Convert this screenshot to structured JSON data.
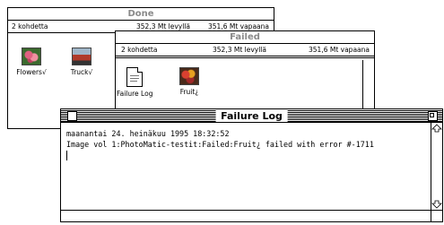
{
  "windows": {
    "done": {
      "title": "Done",
      "items_count": "2 kohdetta",
      "disk_used": "352,3 Mt levyllä",
      "disk_free": "351,6 Mt vapaana",
      "icons": [
        {
          "label": "Flowers√",
          "icon": "photo-flowers-icon"
        },
        {
          "label": "Truck√",
          "icon": "photo-truck-icon"
        }
      ]
    },
    "failed": {
      "title": "Failed",
      "items_count": "2 kohdetta",
      "disk_used": "352,3 Mt levyllä",
      "disk_free": "351,6 Mt vapaana",
      "icons": [
        {
          "label": "Failure Log",
          "icon": "document-icon"
        },
        {
          "label": "Fruit¿",
          "icon": "photo-fruit-icon"
        }
      ]
    },
    "log": {
      "title": "Failure Log",
      "lines": [
        "maanantai 24. heinäkuu 1995 18:32:52",
        "Image vol 1:PhotoMatic-testit:Failed:Fruit¿ failed with error #-1711"
      ]
    }
  }
}
